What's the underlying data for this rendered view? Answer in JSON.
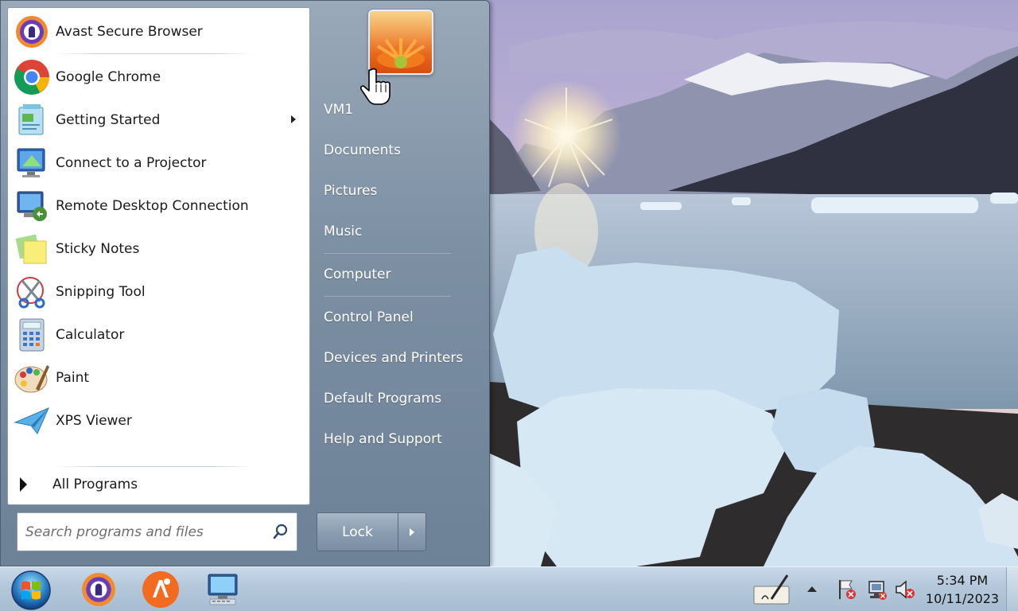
{
  "start_menu": {
    "programs": [
      {
        "label": "Avast Secure Browser",
        "icon": "avast-browser-icon"
      },
      {
        "label": "Google Chrome",
        "icon": "chrome-icon"
      },
      {
        "label": "Getting Started",
        "icon": "getting-started-icon",
        "submenu": true
      },
      {
        "label": "Connect to a Projector",
        "icon": "projector-icon"
      },
      {
        "label": "Remote Desktop Connection",
        "icon": "remote-desktop-icon"
      },
      {
        "label": "Sticky Notes",
        "icon": "sticky-notes-icon"
      },
      {
        "label": "Snipping Tool",
        "icon": "snipping-tool-icon"
      },
      {
        "label": "Calculator",
        "icon": "calculator-icon"
      },
      {
        "label": "Paint",
        "icon": "paint-icon"
      },
      {
        "label": "XPS Viewer",
        "icon": "xps-viewer-icon"
      }
    ],
    "all_programs_label": "All Programs",
    "search_placeholder": "Search programs and files",
    "right_links": [
      "VM1",
      "Documents",
      "Pictures",
      "Music",
      "Computer",
      "Control Panel",
      "Devices and Printers",
      "Default Programs",
      "Help and Support"
    ],
    "shutdown_label": "Lock"
  },
  "taskbar": {
    "apps": [
      "avast-browser-icon",
      "avast-secureline-icon",
      "remote-desktop-icon"
    ],
    "tray_icons": [
      "pen-input-icon",
      "show-hidden-icons-chevron",
      "action-center-flag-icon",
      "network-icon",
      "volume-muted-icon"
    ],
    "time": "5:34 PM",
    "date": "10/11/2023"
  },
  "colors": {
    "start_menu_right": "#7c8fa3",
    "taskbar": "#b6c9dc",
    "accent_avast": "#f36b21"
  }
}
